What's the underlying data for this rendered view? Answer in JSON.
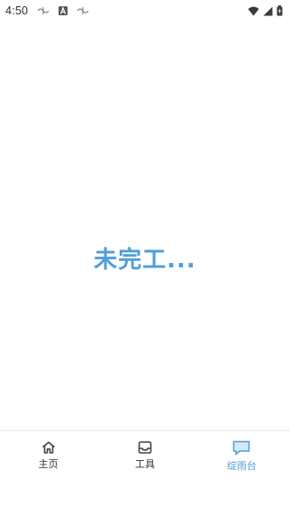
{
  "status_bar": {
    "time": "4:50",
    "icons": [
      "sync-icon",
      "a-icon",
      "sync-icon",
      "wifi-icon",
      "signal-icon",
      "battery-icon"
    ]
  },
  "main": {
    "placeholder": "未完工..."
  },
  "bottom_nav": {
    "items": [
      {
        "label": "主页",
        "icon": "home-icon",
        "active": false
      },
      {
        "label": "工具",
        "icon": "inbox-icon",
        "active": false
      },
      {
        "label": "绽雨台",
        "icon": "chat-bubble-icon",
        "active": true
      }
    ]
  },
  "colors": {
    "accent": "#4f9ed8",
    "text": "#333333"
  }
}
